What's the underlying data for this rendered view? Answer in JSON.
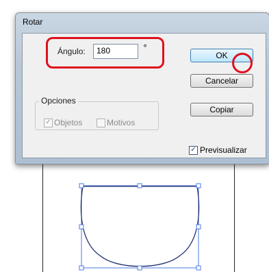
{
  "dialog": {
    "title": "Rotar",
    "angle": {
      "label": "Ángulo:",
      "value": "180",
      "unit": "°"
    },
    "options": {
      "legend": "Opciones",
      "objects": {
        "label": "Objetos",
        "checked": true,
        "enabled": false
      },
      "patterns": {
        "label": "Motivos",
        "checked": false,
        "enabled": false
      }
    },
    "buttons": {
      "ok": "OK",
      "cancel": "Cancelar",
      "copy": "Copiar"
    },
    "preview": {
      "label": "Previsualizar",
      "checked": true
    }
  },
  "colors": {
    "highlight": "#e0101c",
    "selection": "#4a78e0",
    "path": "#1e2f6f"
  }
}
